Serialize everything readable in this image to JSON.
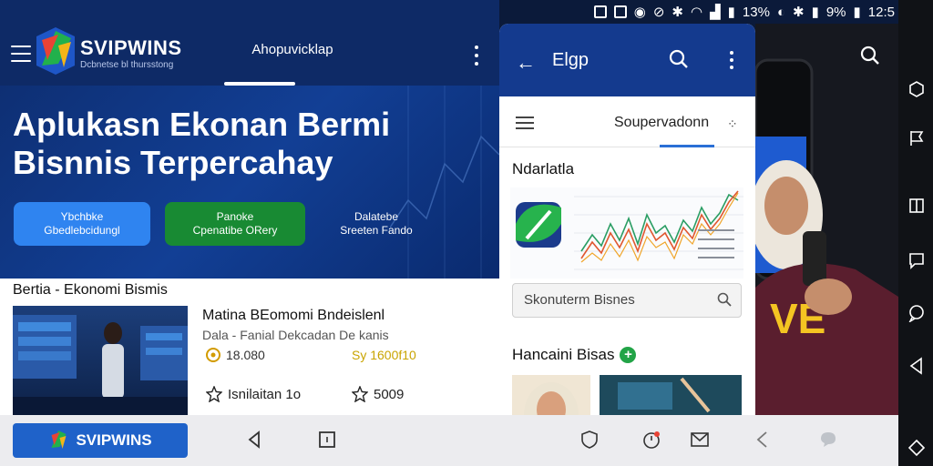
{
  "app": {
    "logo_name": "SVIPWINS",
    "logo_tagline": "Dcbnetse bl thursstong",
    "nav_tab": "Ahopuvicklap",
    "hero_title": "Aplukasn Ekonan Bermi Bisnnis Terpercahay",
    "buttons": [
      {
        "line1": "Ybchbke",
        "line2": "Gbedlebcidungl"
      },
      {
        "line1": "Panoke",
        "line2": "Cpenatibe ORery"
      },
      {
        "line1": "Dalatebe",
        "line2": "Sreeten Fando"
      }
    ]
  },
  "news": {
    "section_title": "Bertia - Ekonomi Bismis",
    "headline": "Matina BEomomi Bndeislenl",
    "subline": "Dala - Fanial Dekcadan De kanis",
    "stat_1": "18.080",
    "stat_2": "Sy 1600f10",
    "like_label": "Isnilaitan 1o",
    "star_count": "5009"
  },
  "status_bar": {
    "battery_1": "13%",
    "battery_2": "9%",
    "time": "12:5"
  },
  "phone": {
    "title": "Elgp",
    "subtab": "Soupervadonn",
    "section_title": "Ndarlatla",
    "search_placeholder": "Skonuterm Bisnes",
    "section_2_title": "Hancaini Bisas",
    "plus": "+"
  },
  "bottom_bar": {
    "brand_label": "SVIPWINS"
  },
  "colors": {
    "brand_blue": "#1f62c9",
    "hero_blue": "#123f95",
    "accent_green": "#188a33",
    "button_blue": "#2f84f0",
    "plus_green": "#22a447"
  },
  "icons": [
    "menu-icon",
    "kebab-icon",
    "back-arrow-icon",
    "search-icon",
    "shield-icon",
    "mail-icon",
    "chat-icon",
    "copy-icon",
    "flag-icon",
    "chevron-left-icon"
  ]
}
